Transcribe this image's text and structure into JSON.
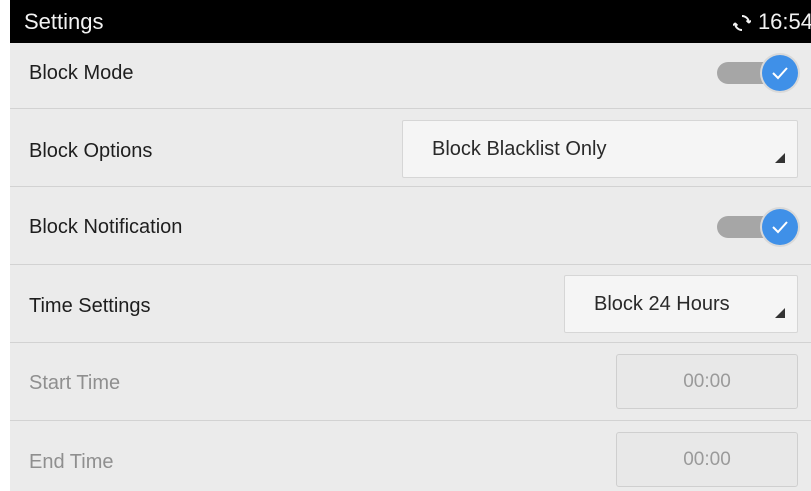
{
  "statusbar": {
    "title": "Settings",
    "clock": "16:54",
    "sync_icon": "sync-icon"
  },
  "rows": {
    "block_mode": {
      "label": "Block Mode",
      "enabled": true
    },
    "block_options": {
      "label": "Block Options",
      "value": "Block Blacklist Only"
    },
    "block_notification": {
      "label": "Block Notification",
      "enabled": true
    },
    "time_settings": {
      "label": "Time Settings",
      "value": "Block 24 Hours"
    },
    "start_time": {
      "label": "Start Time",
      "value": "00:00"
    },
    "end_time": {
      "label": "End Time",
      "value": "00:00"
    }
  },
  "colors": {
    "accent": "#3f90e8",
    "toggle_track": "#a6a6a6",
    "background": "#ebebeb"
  }
}
